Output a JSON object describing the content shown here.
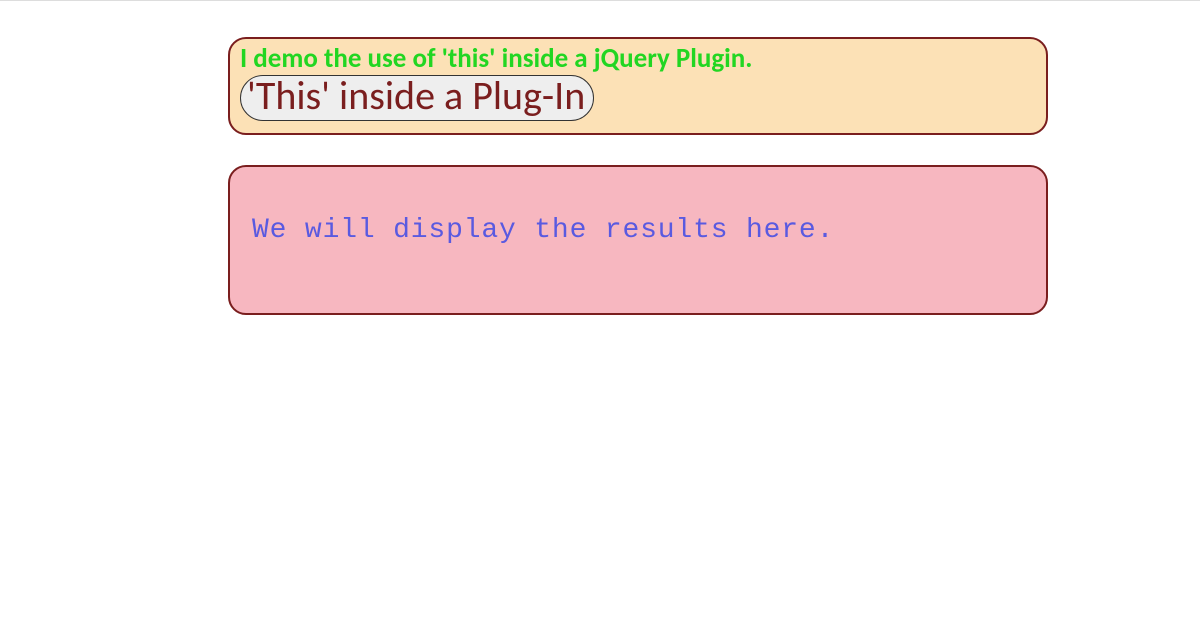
{
  "banner": {
    "heading": "I demo the use of 'this' inside a jQuery Plugin.",
    "button_label": "'This' inside a Plug-In"
  },
  "display": {
    "placeholder_text": "We will display the results here."
  }
}
